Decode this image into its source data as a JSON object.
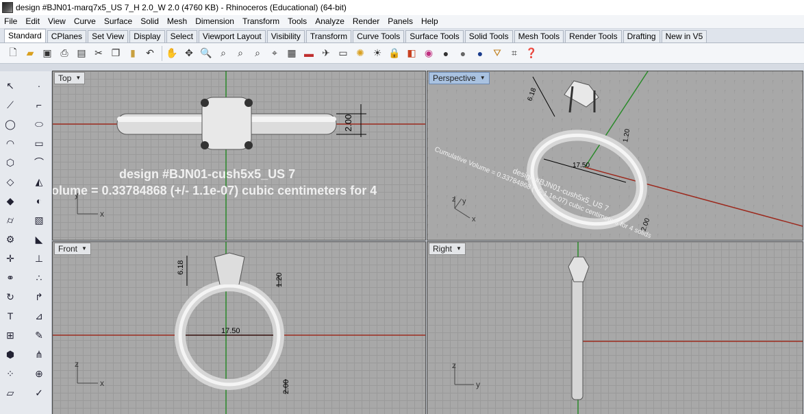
{
  "window": {
    "title": "design #BJN01-marq7x5_US 7_H 2.0_W 2.0 (4760 KB) - Rhinoceros (Educational) (64-bit)"
  },
  "menu": [
    "File",
    "Edit",
    "View",
    "Curve",
    "Surface",
    "Solid",
    "Mesh",
    "Dimension",
    "Transform",
    "Tools",
    "Analyze",
    "Render",
    "Panels",
    "Help"
  ],
  "tabs": [
    {
      "label": "Standard",
      "active": true
    },
    {
      "label": "CPlanes"
    },
    {
      "label": "Set View"
    },
    {
      "label": "Display"
    },
    {
      "label": "Select"
    },
    {
      "label": "Viewport Layout"
    },
    {
      "label": "Visibility"
    },
    {
      "label": "Transform"
    },
    {
      "label": "Curve Tools"
    },
    {
      "label": "Surface Tools"
    },
    {
      "label": "Solid Tools"
    },
    {
      "label": "Mesh Tools"
    },
    {
      "label": "Render Tools"
    },
    {
      "label": "Drafting"
    },
    {
      "label": "New in V5"
    }
  ],
  "toolbar_icons": [
    "new-file",
    "open-file",
    "save",
    "print",
    "import",
    "cut",
    "copy",
    "paste",
    "undo",
    "pan",
    "rotate-view",
    "zoom",
    "zoom-window",
    "zoom-extents",
    "zoom-selected",
    "four-viewports",
    "car",
    "plane",
    "truck",
    "light",
    "bulb",
    "lock",
    "layers",
    "color-wheel",
    "shade-sphere",
    "render-sphere",
    "material-sphere",
    "filter",
    "grip",
    "help"
  ],
  "viewports": {
    "top": {
      "label": "Top",
      "name": "design #BJN01-cush5x5_US 7",
      "volume": "olume = 0.33784868 (+/- 1.1e-07) cubic centimeters for 4",
      "dim_width": "2.00"
    },
    "perspective": {
      "label": "Perspective",
      "dim_height": "6.18",
      "dim_small": "1.20",
      "dim_diameter": "17.50",
      "dim_bottom": "2.00",
      "overlay_name": "design #BJN01-cush5x5_US 7",
      "overlay_volume": "Cumulative Volume = 0.33784868 (+/- 1.1e-07) cubic centimeters for 4 solids"
    },
    "front": {
      "label": "Front",
      "dim_height": "6.18",
      "dim_small": "1.20",
      "dim_diameter": "17.50",
      "dim_bottom": "2.00"
    },
    "right": {
      "label": "Right"
    }
  },
  "axis_labels": {
    "x": "x",
    "y": "y",
    "z": "z"
  },
  "colors": {
    "viewport_bg": "#a8a8a8",
    "grid": "#9a9a9a",
    "x_axis": "#9c2a1e",
    "y_axis": "#2a8a2a",
    "active_label": "#a9c2e1"
  }
}
